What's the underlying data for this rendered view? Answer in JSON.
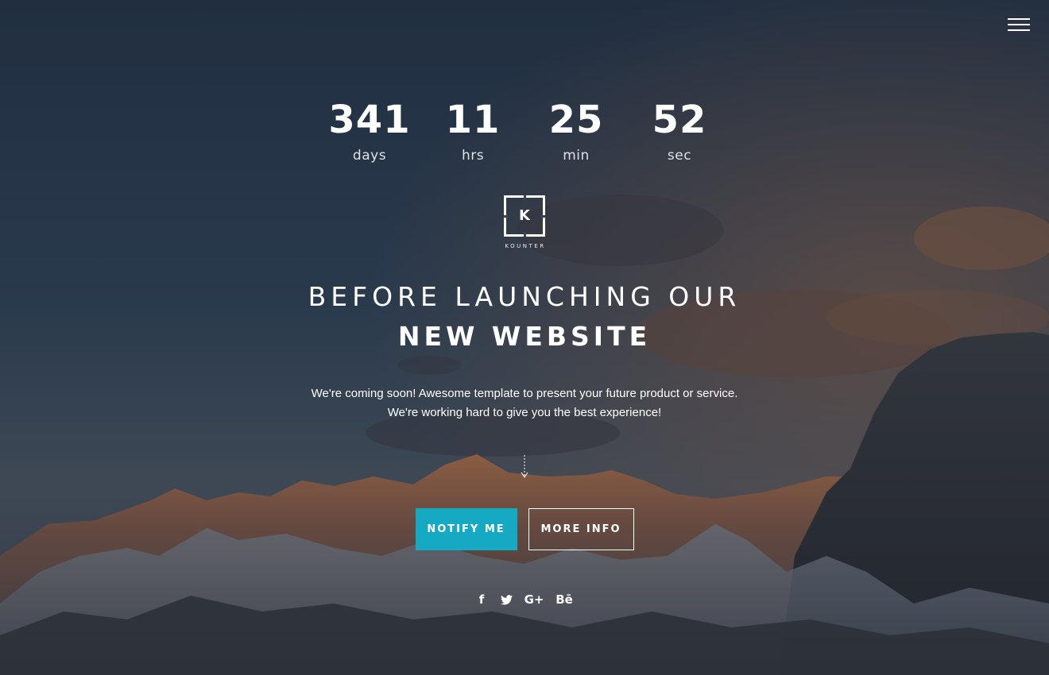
{
  "menu": {
    "icon": "hamburger-menu-icon"
  },
  "countdown": [
    {
      "value": "341",
      "label": "days"
    },
    {
      "value": "11",
      "label": "hrs"
    },
    {
      "value": "25",
      "label": "min"
    },
    {
      "value": "52",
      "label": "sec"
    }
  ],
  "logo": {
    "letter": "K",
    "wordmark": "KOUNTER"
  },
  "headline": {
    "line1": "BEFORE LAUNCHING OUR",
    "line2": "NEW WEBSITE"
  },
  "description": {
    "line1": "We're coming soon! Awesome template to present your future product or service.",
    "line2": "We're working hard to give you the best experience!"
  },
  "scroll_indicator": {
    "icon": "arrow-down-icon"
  },
  "buttons": {
    "notify": "NOTIFY ME",
    "more": "MORE INFO"
  },
  "social": [
    {
      "icon": "facebook-icon",
      "glyph": "f"
    },
    {
      "icon": "twitter-icon",
      "glyph": ""
    },
    {
      "icon": "google-plus-icon",
      "glyph": "G+"
    },
    {
      "icon": "behance-icon",
      "glyph": "Bē"
    }
  ],
  "colors": {
    "accent": "#16a9c4",
    "sky_top": "#233347",
    "text": "#ffffff"
  }
}
